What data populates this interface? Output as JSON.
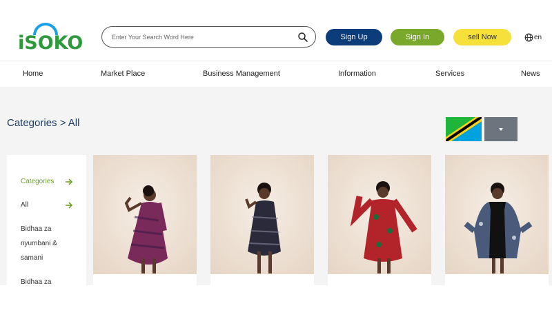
{
  "logo": {
    "text": "iSOKO"
  },
  "search": {
    "placeholder": "Enter Your Search Word Here"
  },
  "header_buttons": {
    "signup": "Sign Up",
    "signin": "Sign In",
    "sell": "sell Now"
  },
  "language": {
    "code": "en"
  },
  "nav": [
    "Home",
    "Market Place",
    "Business Management",
    "Information",
    "Services",
    "News"
  ],
  "page": {
    "title": "Categories > All"
  },
  "sidebar": {
    "items": [
      {
        "label": "Categories",
        "arrow": true
      },
      {
        "label": "All",
        "arrow": true
      },
      {
        "label": "Bidhaa za nyumbani & samani",
        "arrow": false
      },
      {
        "label": "Bidhaa za",
        "arrow": false
      }
    ]
  },
  "products": [
    {
      "icon": "dress-purple-print",
      "color": "#7a2a5a"
    },
    {
      "icon": "dress-black-print",
      "color": "#2a2a3a"
    },
    {
      "icon": "dress-red-print",
      "color": "#b3242a"
    },
    {
      "icon": "kimono-blue-print",
      "color": "#4a5a7a"
    }
  ],
  "colors": {
    "primary": "#0d3c7a",
    "green": "#7aa82a",
    "yellow": "#f5e13a",
    "logo_green": "#2f9a3c",
    "logo_blue": "#1aa0e8",
    "title": "#1b3a66"
  }
}
